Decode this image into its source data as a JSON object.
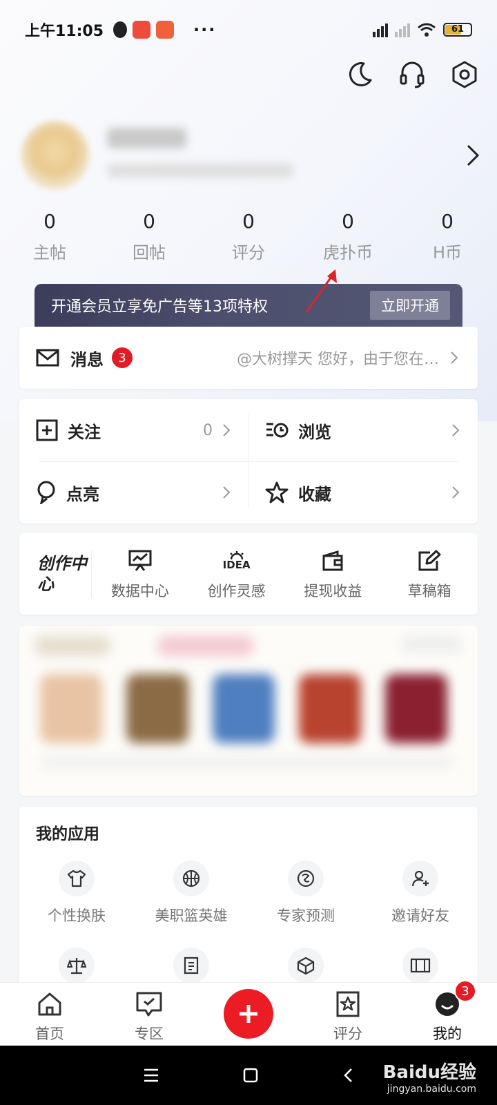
{
  "status_bar": {
    "time": "上午11:05",
    "more": "···",
    "battery": "61"
  },
  "header": {
    "icons": [
      "moon-icon",
      "headset-icon",
      "settings-icon"
    ]
  },
  "stats": [
    {
      "value": "0",
      "label": "主帖"
    },
    {
      "value": "0",
      "label": "回帖"
    },
    {
      "value": "0",
      "label": "评分"
    },
    {
      "value": "0",
      "label": "虎扑币"
    },
    {
      "value": "0",
      "label": "H币"
    }
  ],
  "vip": {
    "text": "开通会员立享免广告等13项特权",
    "button": "立即开通"
  },
  "messages": {
    "title": "消息",
    "badge": "3",
    "preview": "@大树撑天 您好，由于您在…"
  },
  "grid": {
    "follow": {
      "label": "关注",
      "count": "0"
    },
    "browse": {
      "label": "浏览"
    },
    "light": {
      "label": "点亮"
    },
    "favorites": {
      "label": "收藏"
    }
  },
  "create_center": {
    "logo": "创作中心",
    "items": [
      "数据中心",
      "创作灵感",
      "提现收益",
      "草稿箱"
    ],
    "idea_text": "IDEA"
  },
  "apps": {
    "title": "我的应用",
    "items": [
      "个性换肤",
      "美职篮英雄",
      "专家预测",
      "邀请好友"
    ]
  },
  "tabbar": {
    "items": [
      "首页",
      "专区",
      "评分",
      "我的"
    ],
    "badge": "3"
  },
  "watermark": {
    "brand": "Baidu经验",
    "url": "jingyan.baidu.com"
  },
  "colors": {
    "accent": "#ec1c24",
    "badge": "#e21b25",
    "vip_bg": "#4c4f6d"
  }
}
